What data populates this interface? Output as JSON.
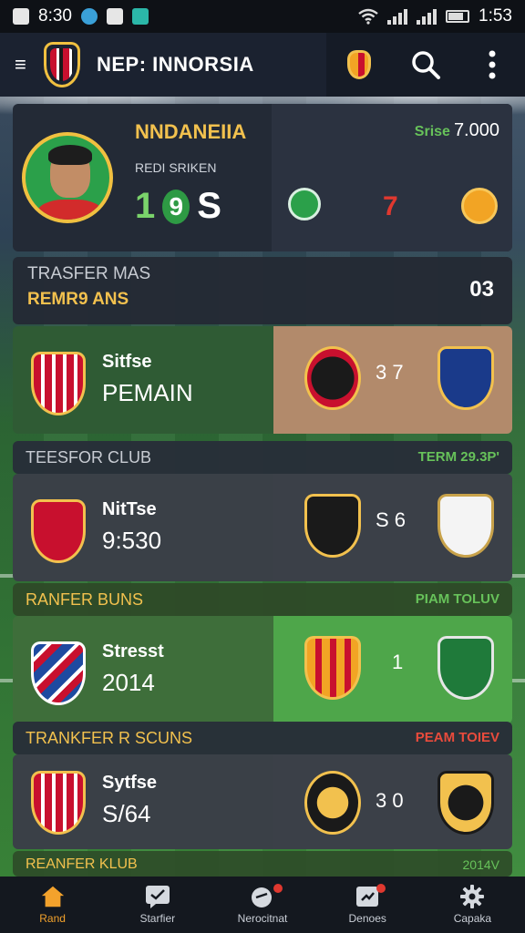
{
  "status_bar": {
    "time_left": "8:30",
    "time_right": "1:53"
  },
  "header": {
    "menu_icon": "≡",
    "title": "NEP: INNORSIA"
  },
  "hero": {
    "name": "NNDANEIIA",
    "subtitle": "REDI SRIKEN",
    "score_digits": [
      "1",
      "9",
      "S"
    ],
    "stat_label": "Srise",
    "stat_value": "7.000",
    "center_number": "7"
  },
  "section_transfer": {
    "title": "TRASFER MAS",
    "subtitle": "REMR9 ANS",
    "value": "03"
  },
  "match_1": {
    "label": "Sitfse",
    "value": "PEMAIN",
    "score": "3 7"
  },
  "bar_1": {
    "left": "TEESFOR CLUB",
    "right": "TERM 29.3P'"
  },
  "match_2": {
    "label": "NitTse",
    "value": "9:530",
    "score": "S 6"
  },
  "bar_2": {
    "left": "RANFER BUNS",
    "right": "PIAM TOLUV"
  },
  "match_3": {
    "label": "Stresst",
    "value": "2014",
    "score": "1"
  },
  "bar_3": {
    "left": "TRANKFER R SCUNS",
    "right": "PEAM TOIEV"
  },
  "match_4": {
    "label": "Sytfse",
    "value": "S/64",
    "score": "3 0"
  },
  "bottom_strip": {
    "left": "REANFER KLUB",
    "right": "2014V"
  },
  "nav": [
    {
      "label": "Rand",
      "icon": "home-icon"
    },
    {
      "label": "Starfier",
      "icon": "chat-icon"
    },
    {
      "label": "Nerocitnat",
      "icon": "whistle-icon"
    },
    {
      "label": "Denoes",
      "icon": "transfer-icon"
    },
    {
      "label": "Capaka",
      "icon": "gear-icon"
    }
  ],
  "colors": {
    "accent": "#f2c14e",
    "green": "#67c25a",
    "red": "#e0382f",
    "nav_active": "#f3a22c"
  }
}
